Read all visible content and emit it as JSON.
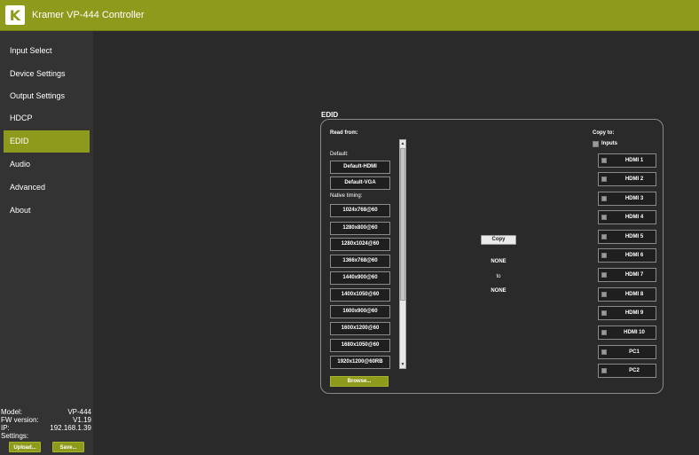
{
  "app": {
    "title": "Kramer VP-444 Controller",
    "logo_letter": "K"
  },
  "sidebar": {
    "items": [
      {
        "label": "Input Select"
      },
      {
        "label": "Device Settings"
      },
      {
        "label": "Output Settings"
      },
      {
        "label": "HDCP"
      },
      {
        "label": "EDID"
      },
      {
        "label": "Audio"
      },
      {
        "label": "Advanced"
      },
      {
        "label": "About"
      }
    ],
    "active": "EDID",
    "info": {
      "model_label": "Model:",
      "model_value": "VP-444",
      "fw_label": "FW version:",
      "fw_value": "V1.19",
      "ip_label": "IP:",
      "ip_value": "192.168.1.39",
      "settings_label": "Settings:"
    },
    "upload_label": "Upload...",
    "save_label": "Save..."
  },
  "edid": {
    "title": "EDID",
    "read_from_label": "Read from:",
    "default_label": "Default:",
    "default_items": [
      "Default-HDMI",
      "Default-VGA"
    ],
    "native_label": "Native timing:",
    "native_items": [
      "1024x768@60",
      "1280x800@60",
      "1280x1024@60",
      "1366x768@60",
      "1440x900@60",
      "1400x1050@60",
      "1600x900@60",
      "1600x1200@60",
      "1680x1050@60",
      "1920x1200@60RB"
    ],
    "browse_label": "Browse...",
    "copy_label": "Copy",
    "source_text": "NONE",
    "to_text": "to",
    "dest_text": "NONE",
    "copy_to_label": "Copy to:",
    "inputs_label": "Inputs",
    "targets": [
      "HDMI 1",
      "HDMI 2",
      "HDMI 3",
      "HDMI 4",
      "HDMI 5",
      "HDMI 6",
      "HDMI 7",
      "HDMI 8",
      "HDMI 9",
      "HDMI 10",
      "PC1",
      "PC2"
    ]
  },
  "colors": {
    "accent": "#8e9a1b",
    "background": "#222222",
    "sidebar": "#333333"
  }
}
